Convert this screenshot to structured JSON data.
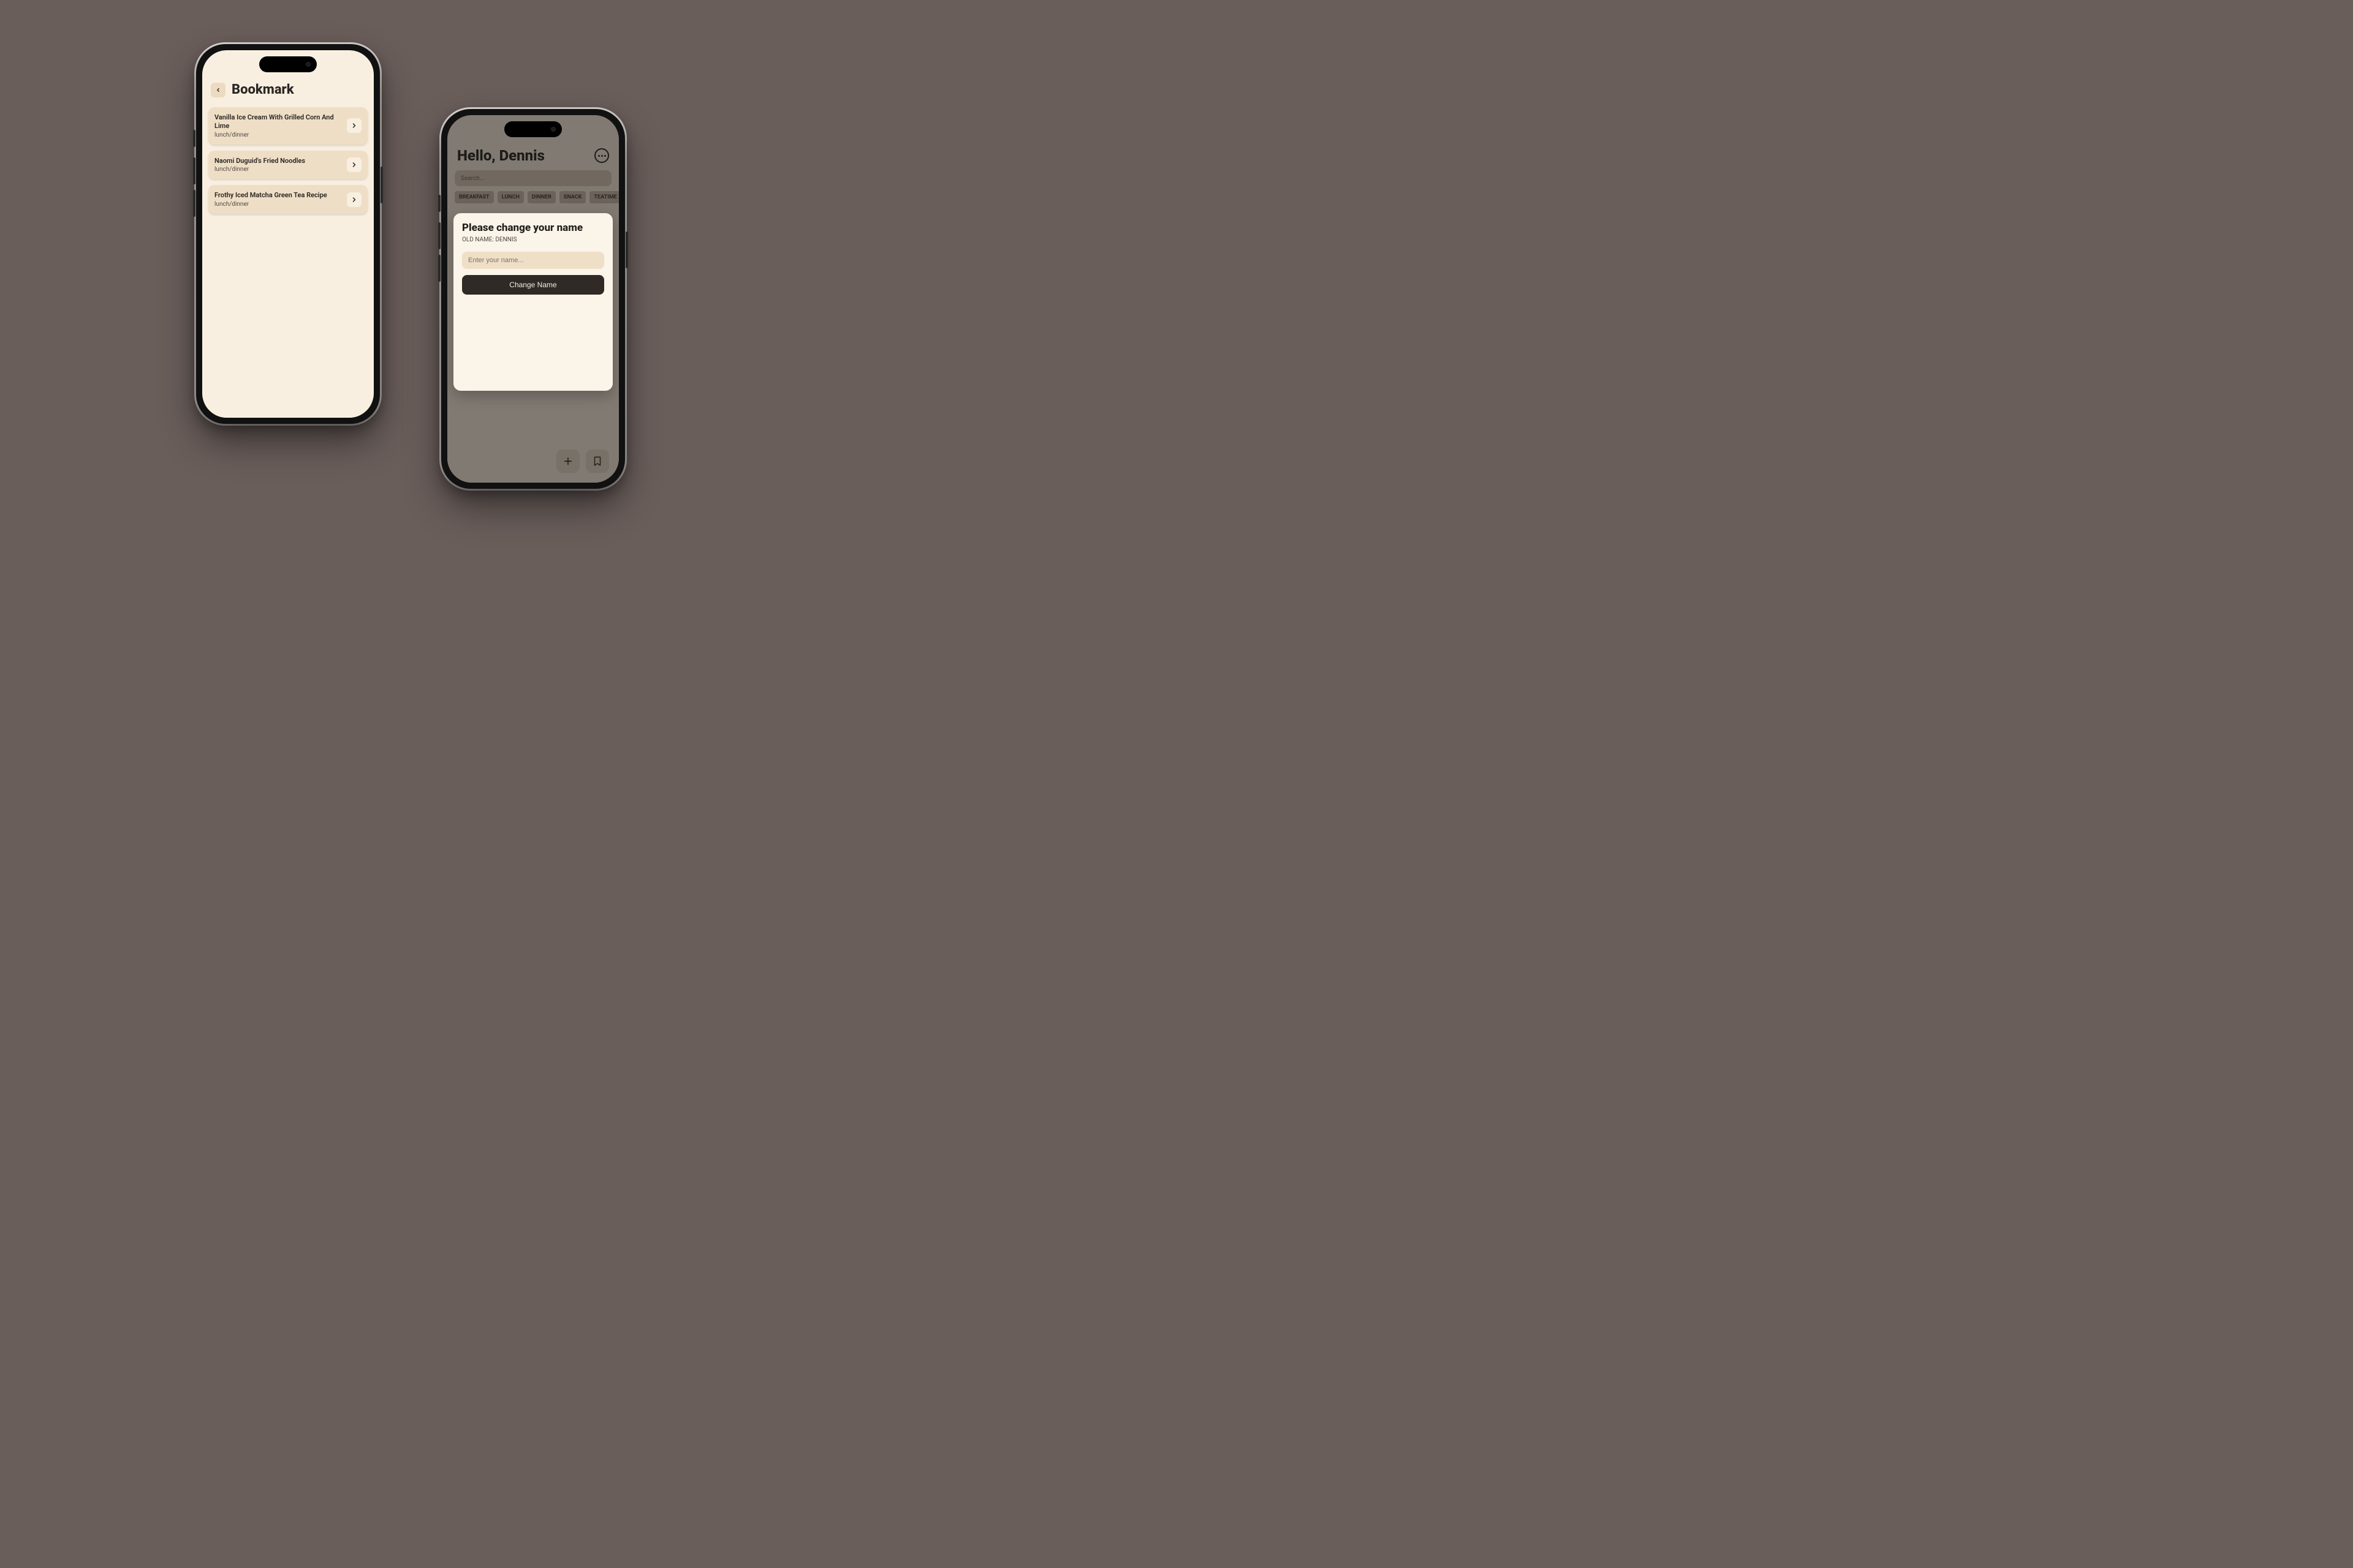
{
  "left": {
    "title": "Bookmark",
    "items": [
      {
        "title": "Vanilla Ice Cream With Grilled Corn And Lime",
        "meal": "lunch/dinner"
      },
      {
        "title": "Naomi Duguid's Fried Noodles",
        "meal": "lunch/dinner"
      },
      {
        "title": "Frothy Iced Matcha Green Tea Recipe",
        "meal": "lunch/dinner"
      }
    ]
  },
  "right": {
    "greeting": "Hello, Dennis",
    "search_placeholder": "Search...",
    "chips": [
      "BREAKFAST",
      "LUNCH",
      "DINNER",
      "SNACK",
      "TEATIME"
    ],
    "modal": {
      "title": "Please change your name",
      "subtitle": "OLD NAME: DENNIS",
      "input_placeholder": "Enter your name...",
      "button": "Change Name"
    }
  }
}
